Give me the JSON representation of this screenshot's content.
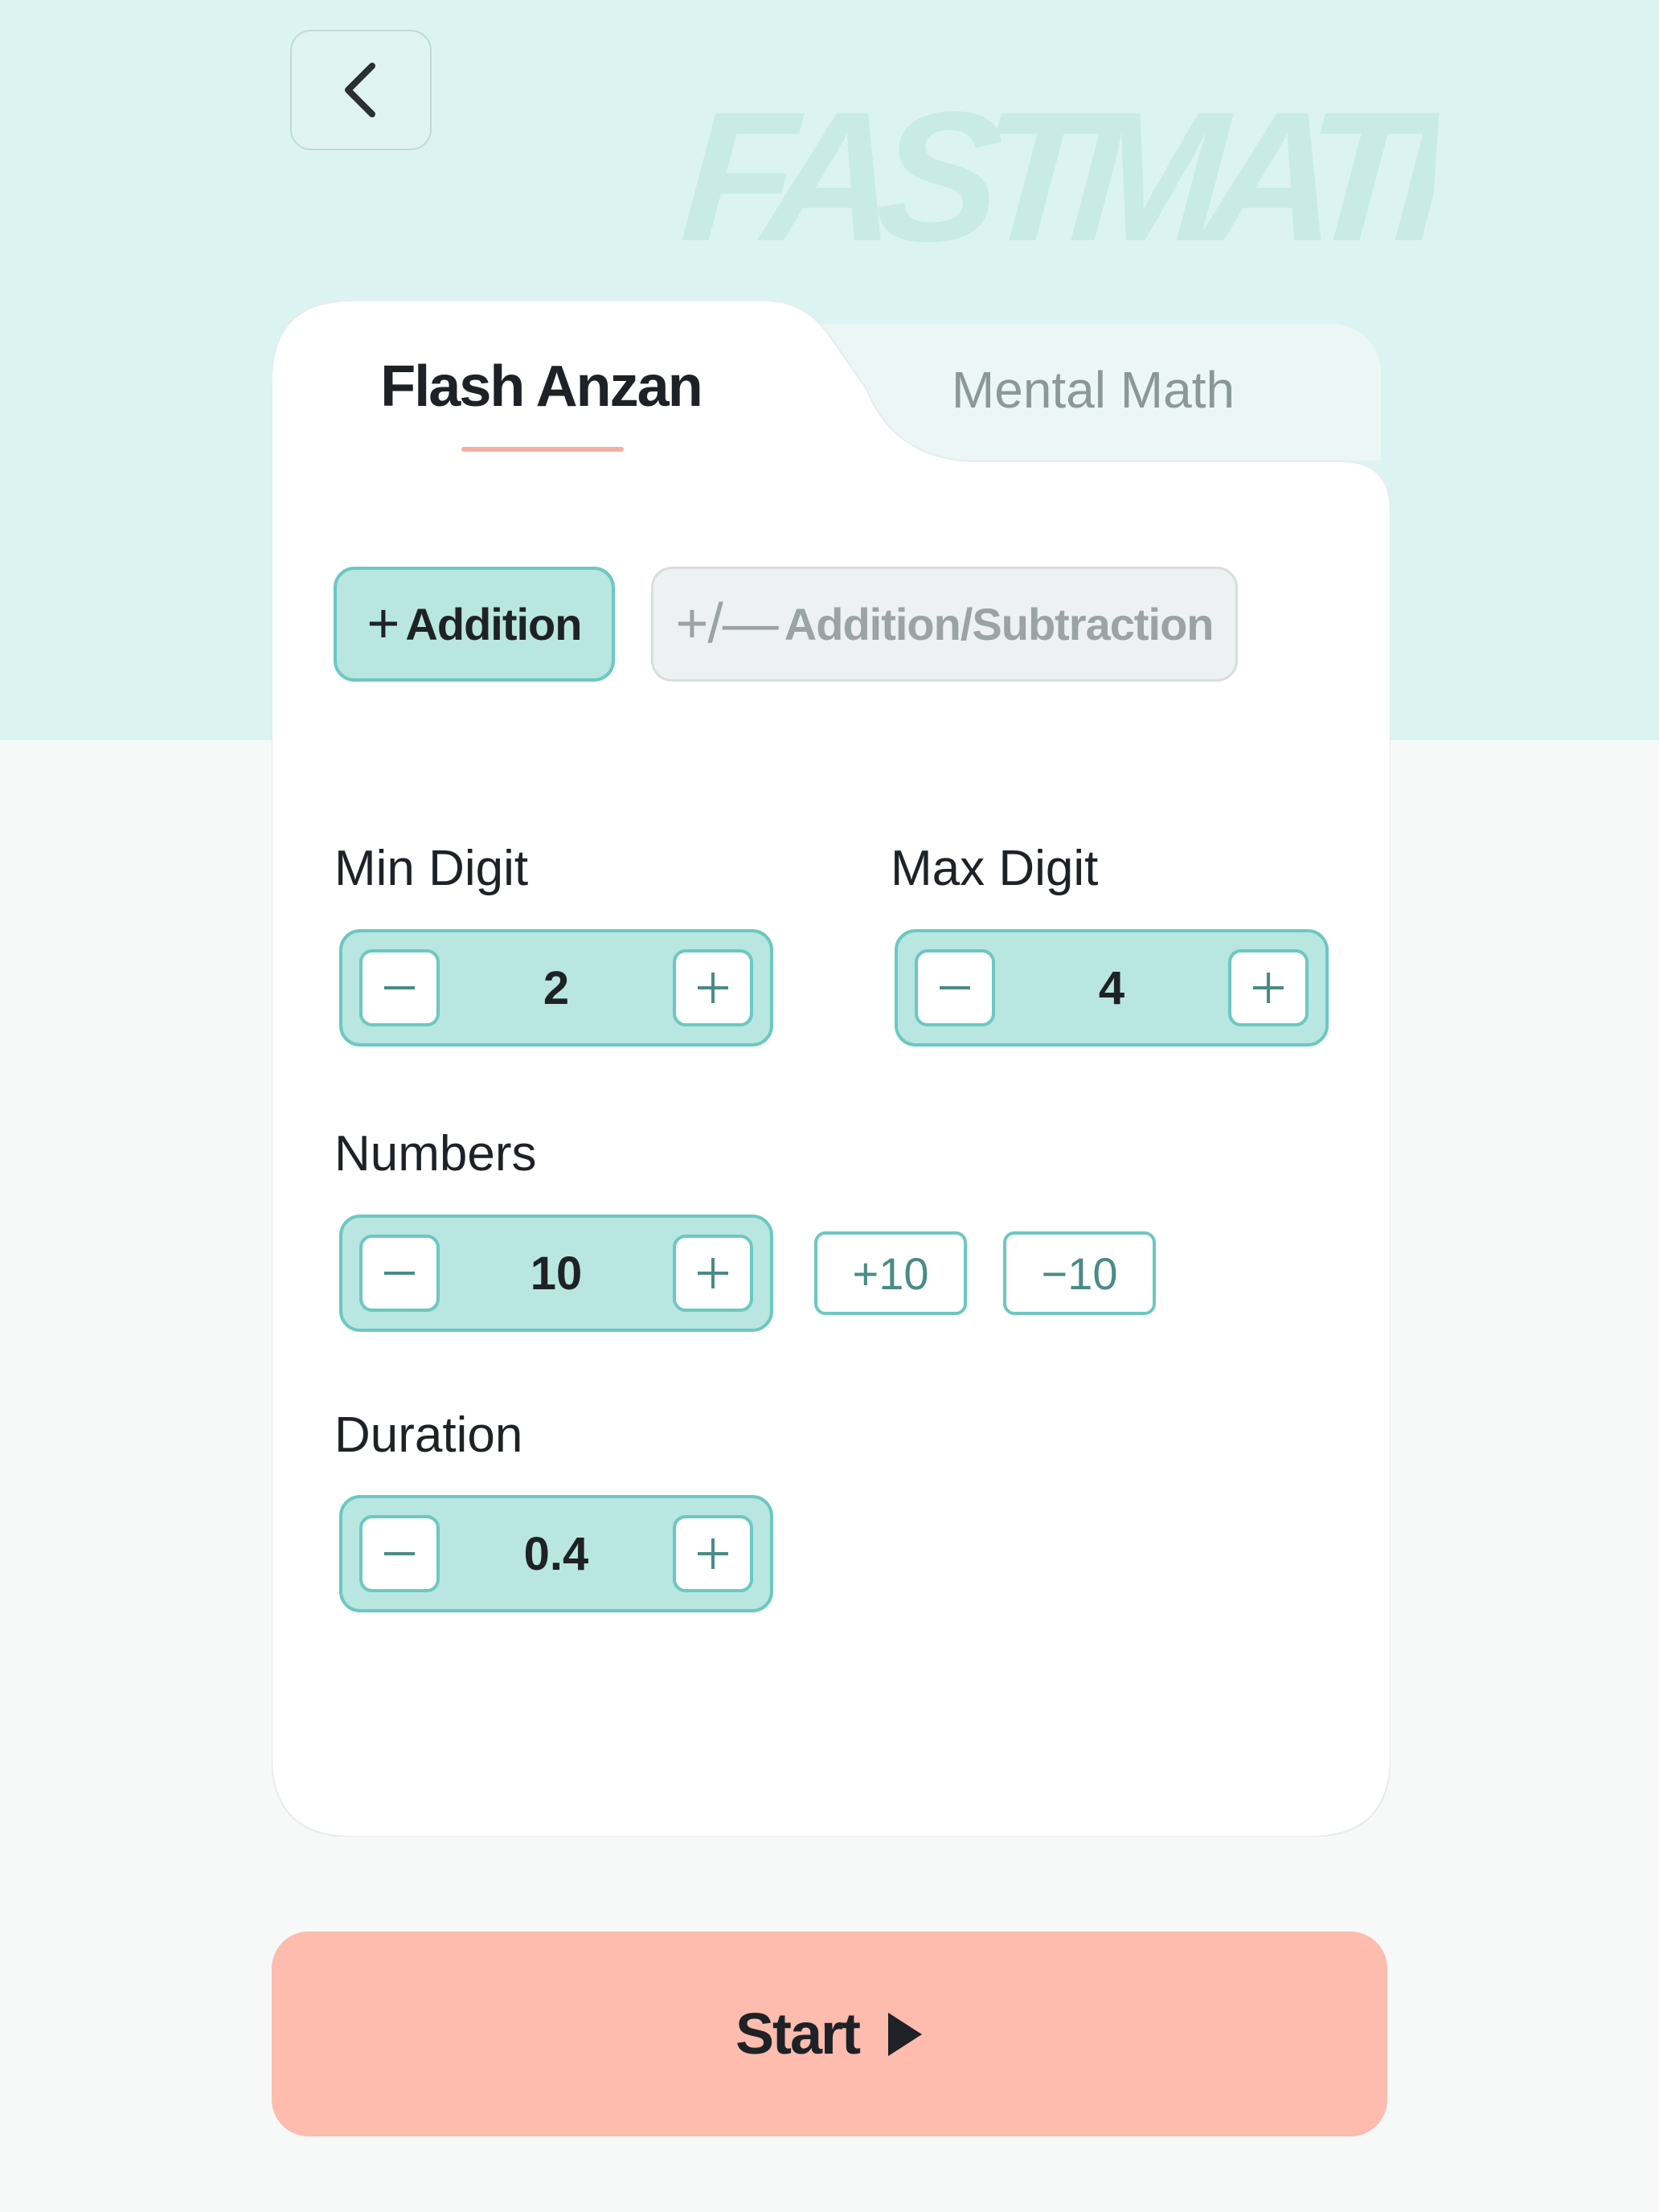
{
  "header": {
    "back_icon": "chevron-left-icon",
    "wordmark": "FASTMATH"
  },
  "tabs": [
    {
      "label": "Flash Anzan",
      "active": true
    },
    {
      "label": "Mental Math",
      "active": false
    }
  ],
  "operations": {
    "addition": {
      "icon": "plus",
      "sign": "+",
      "label": "Addition",
      "selected": true
    },
    "addition_subtraction": {
      "icon": "plus-slash-minus",
      "sign": "+/—",
      "label": "Addition/Subtraction",
      "selected": false
    }
  },
  "settings": {
    "min_digit": {
      "label": "Min Digit",
      "value": "2"
    },
    "max_digit": {
      "label": "Max Digit",
      "value": "4"
    },
    "numbers": {
      "label": "Numbers",
      "value": "10",
      "quick_add": "+10",
      "quick_sub": "−10"
    },
    "duration": {
      "label": "Duration",
      "value": "0.4"
    }
  },
  "start": {
    "label": "Start",
    "icon": "play-icon"
  },
  "colors": {
    "top_band": "#dcf4f1",
    "accent_teal": "#6cc8c0",
    "stepper_fill": "#b9e6e1",
    "start_button": "#fdbcad",
    "tab_underline": "#f4b09e"
  }
}
